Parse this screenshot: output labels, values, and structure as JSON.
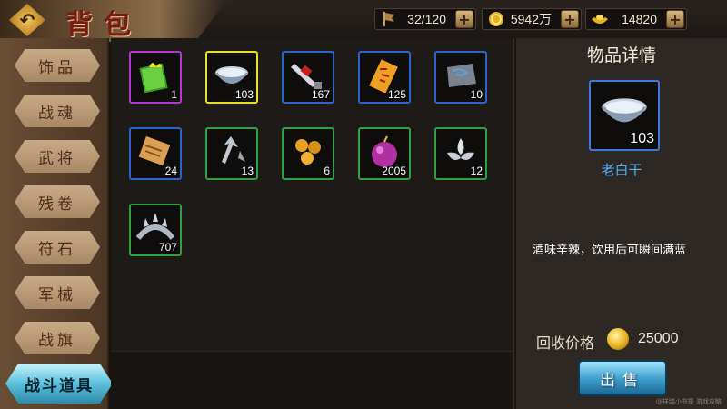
{
  "header": {
    "back_icon": "back-arrow-icon",
    "title": "背包",
    "resources": [
      {
        "icon": "banner-flag-icon",
        "value": "32/120"
      },
      {
        "icon": "gold-coin-icon",
        "value": "5942万"
      },
      {
        "icon": "gold-ingot-icon",
        "value": "14820"
      }
    ],
    "plus_label": "+"
  },
  "sidebar": {
    "items": [
      {
        "label": "饰品",
        "active": false
      },
      {
        "label": "战魂",
        "active": false
      },
      {
        "label": "武将",
        "active": false
      },
      {
        "label": "残卷",
        "active": false
      },
      {
        "label": "符石",
        "active": false
      },
      {
        "label": "军械",
        "active": false
      },
      {
        "label": "战旗",
        "active": false
      },
      {
        "label": "战斗道具",
        "active": true
      }
    ]
  },
  "inventory": {
    "items": [
      {
        "icon": "green-book-icon",
        "count": "1",
        "border": "#b03ad0"
      },
      {
        "icon": "white-bowl-icon",
        "count": "103",
        "border": "#e8e020"
      },
      {
        "icon": "red-sword-icon",
        "count": "167",
        "border": "#2a66c8"
      },
      {
        "icon": "orange-talisman-icon",
        "count": "125",
        "border": "#2a66c8"
      },
      {
        "icon": "stone-tablet-icon",
        "count": "10",
        "border": "#2a66c8"
      },
      {
        "icon": "scroll-icon",
        "count": "24",
        "border": "#2a66c8"
      },
      {
        "icon": "arrowheads-icon",
        "count": "13",
        "border": "#30a040"
      },
      {
        "icon": "golden-orbs-icon",
        "count": "6",
        "border": "#30a040"
      },
      {
        "icon": "bomb-icon",
        "count": "2005",
        "border": "#30a040"
      },
      {
        "icon": "silver-flower-icon",
        "count": "12",
        "border": "#30a040"
      },
      {
        "icon": "spiked-ring-icon",
        "count": "707",
        "border": "#30a040"
      }
    ]
  },
  "detail": {
    "title": "物品详情",
    "item_icon": "white-bowl-icon",
    "count": "103",
    "name": "老白干",
    "description": "酒味辛辣，饮用后可瞬间满蓝",
    "price_label": "回收价格",
    "price_icon": "gold-coin-icon",
    "price": "25000",
    "sell_label": "出售"
  },
  "watermark": "@祥瑞小书童 游戏攻略"
}
